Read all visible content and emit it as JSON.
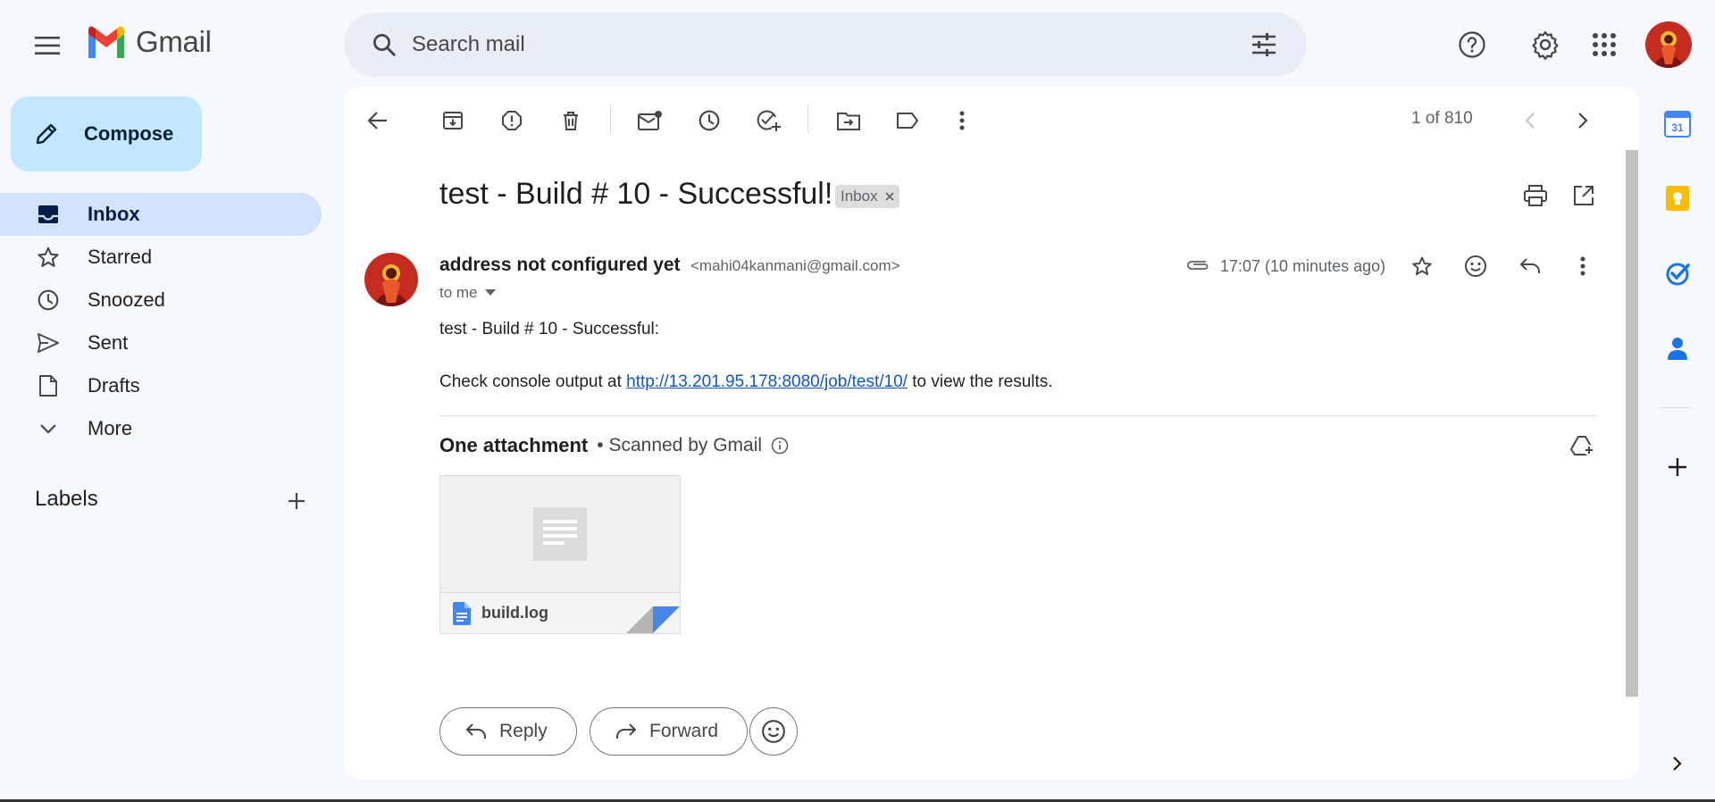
{
  "app": {
    "name": "Gmail"
  },
  "search": {
    "placeholder": "Search mail"
  },
  "compose": {
    "label": "Compose"
  },
  "nav": {
    "items": [
      {
        "label": "Inbox",
        "icon": "inbox-icon",
        "active": true
      },
      {
        "label": "Starred",
        "icon": "star-icon"
      },
      {
        "label": "Snoozed",
        "icon": "clock-icon"
      },
      {
        "label": "Sent",
        "icon": "send-icon"
      },
      {
        "label": "Drafts",
        "icon": "draft-icon"
      },
      {
        "label": "More",
        "icon": "chevron-down-icon"
      }
    ],
    "labels_title": "Labels"
  },
  "toolbar": {
    "page_count": "1 of 810"
  },
  "email": {
    "subject": "test - Build # 10 - Successful!",
    "chip": "Inbox",
    "sender_name": "address not configured yet",
    "sender_email": "<mahi04kanmani@gmail.com>",
    "to": "to me",
    "time": "17:07 (10 minutes ago)",
    "body_line1": "test - Build # 10 - Successful:",
    "body_prefix": "Check console output at ",
    "body_link": "http://13.201.95.178:8080/job/test/10/",
    "body_suffix": " to view the results."
  },
  "attachments": {
    "title": "One attachment",
    "scanned": "• Scanned by Gmail",
    "file_name": "build.log"
  },
  "actions": {
    "reply": "Reply",
    "forward": "Forward"
  },
  "colors": {
    "background": "#f6f8fc",
    "compose_bg": "#c2e7ff",
    "active_nav": "#d3e3fd",
    "search_bg": "#e9eef6",
    "link": "#1155cc"
  }
}
